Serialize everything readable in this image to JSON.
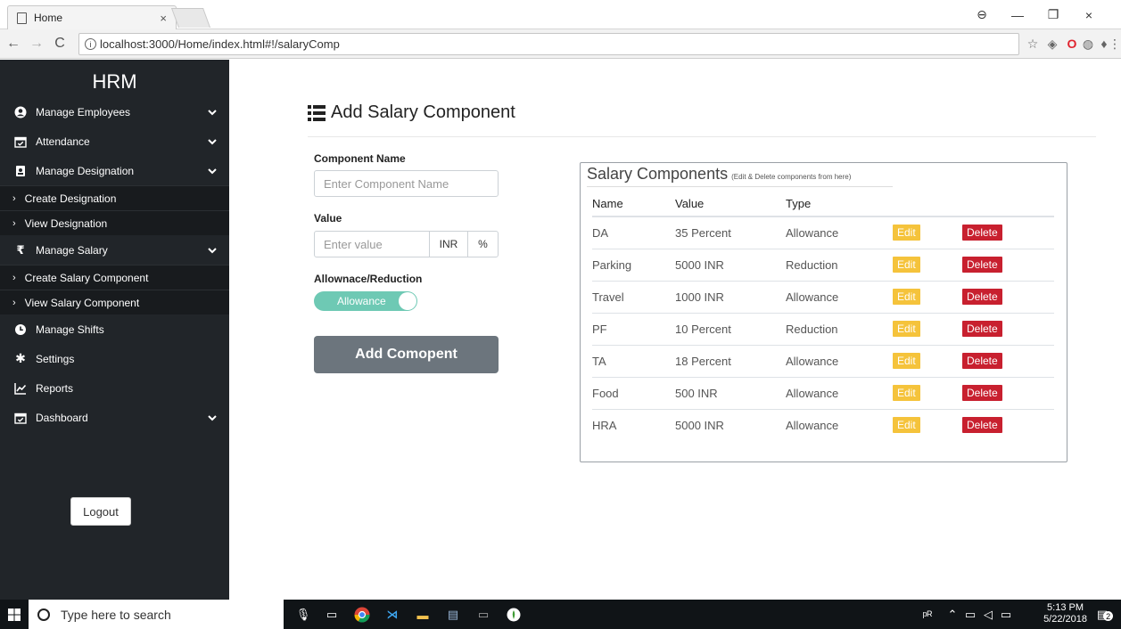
{
  "browser": {
    "tab_title": "Home",
    "tab_close": "×",
    "url": "localhost:3000/Home/index.html#!/salaryComp",
    "window_controls": [
      "⊖",
      "—",
      "❐",
      "×"
    ]
  },
  "sidebar": {
    "brand": "HRM",
    "items": [
      {
        "label": "Manage Employees",
        "icon": "user-circle-icon",
        "chev": "❯"
      },
      {
        "label": "Attendance",
        "icon": "calendar-check-icon",
        "chev": "❯"
      },
      {
        "label": "Manage Designation",
        "icon": "id-badge-icon",
        "chev": "❯"
      }
    ],
    "designation_sub": [
      {
        "label": "Create Designation"
      },
      {
        "label": "View Designation"
      }
    ],
    "salary_item": {
      "label": "Manage Salary",
      "icon": "rupee-icon",
      "symbol": "₹"
    },
    "salary_sub": [
      {
        "label": "Create Salary Component"
      },
      {
        "label": "View Salary Component"
      }
    ],
    "bottom_items": [
      {
        "label": "Manage Shifts",
        "icon": "clock-icon"
      },
      {
        "label": "Settings",
        "icon": "cog-icon"
      },
      {
        "label": "Reports",
        "icon": "chart-line-icon"
      },
      {
        "label": "Dashboard",
        "icon": "calendar-check-icon"
      }
    ],
    "logout": "Logout"
  },
  "form": {
    "title": "Add Salary Component",
    "component_name_label": "Component Name",
    "component_name_placeholder": "Enter Component Name",
    "value_label": "Value",
    "value_placeholder": "Enter value",
    "unit_inr": "INR",
    "unit_percent": "%",
    "type_label": "Allownace/Reduction",
    "toggle_value": "Allowance",
    "submit": "Add Comopent"
  },
  "table": {
    "title": "Salary Components",
    "subtitle": "(Edit & Delete components from here)",
    "headers": [
      "Name",
      "Value",
      "Type"
    ],
    "edit_label": "Edit",
    "delete_label": "Delete",
    "rows": [
      {
        "name": "DA",
        "value": "35 Percent",
        "type": "Allowance"
      },
      {
        "name": "Parking",
        "value": "5000 INR",
        "type": "Reduction"
      },
      {
        "name": "Travel",
        "value": "1000 INR",
        "type": "Allowance"
      },
      {
        "name": "PF",
        "value": "10 Percent",
        "type": "Reduction"
      },
      {
        "name": "TA",
        "value": "18 Percent",
        "type": "Allowance"
      },
      {
        "name": "Food",
        "value": "500 INR",
        "type": "Allowance"
      },
      {
        "name": "HRA",
        "value": "5000 INR",
        "type": "Allowance"
      }
    ]
  },
  "taskbar": {
    "search_placeholder": "Type here to search",
    "time": "5:13 PM",
    "date": "5/22/2018",
    "notif_count": "2"
  },
  "colors": {
    "sidebar_bg": "#212529",
    "edit": "#f5c33b",
    "delete": "#c8202f",
    "toggle": "#6ec9b4",
    "button": "#6c757d"
  }
}
